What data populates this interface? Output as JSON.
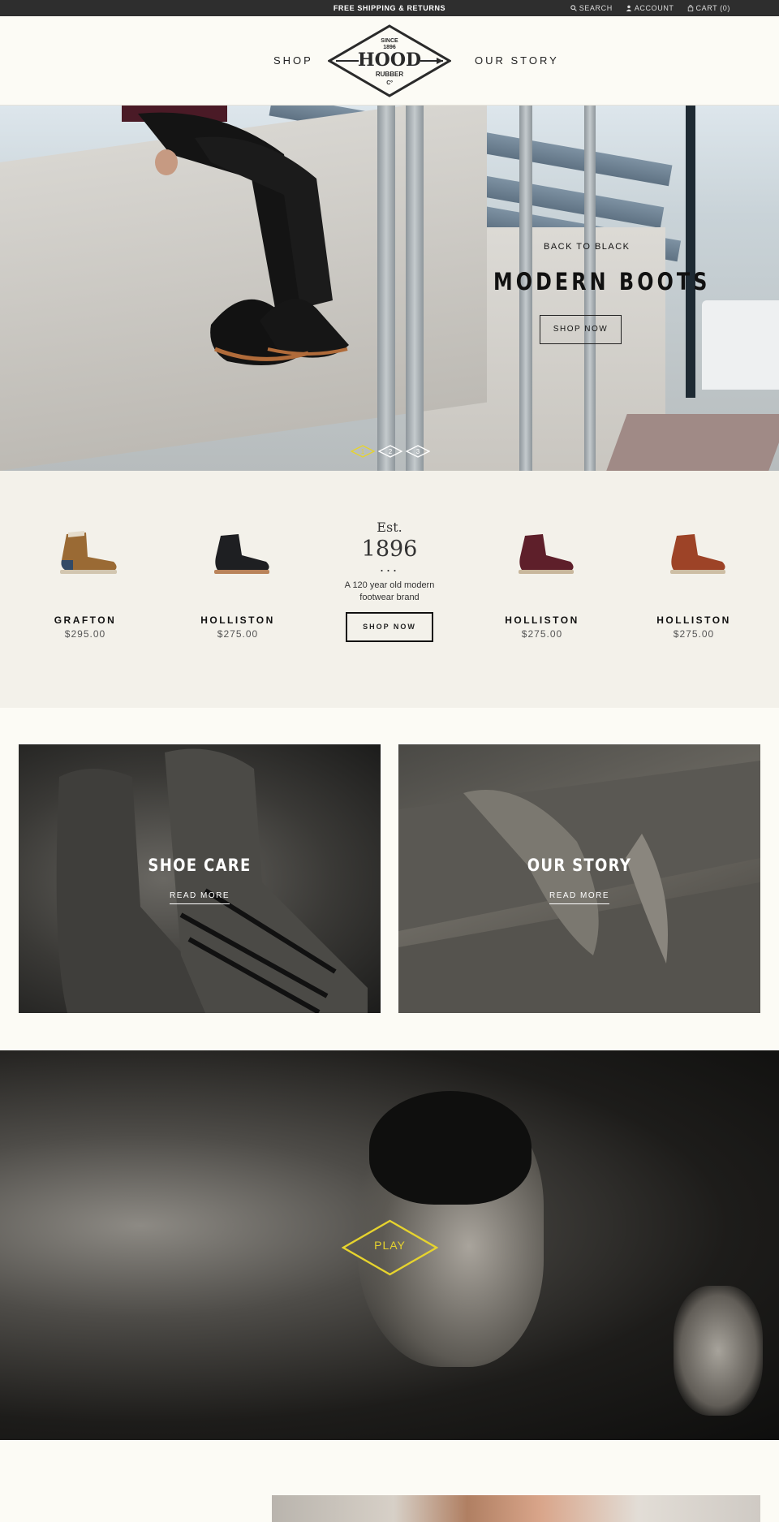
{
  "topbar": {
    "promo": "FREE SHIPPING & RETURNS",
    "search": "SEARCH",
    "account": "ACCOUNT",
    "cart": "CART (0)"
  },
  "header": {
    "nav_shop": "SHOP",
    "nav_story": "OUR STORY",
    "logo": {
      "since": "SINCE",
      "year": "1896",
      "name": "HOOD",
      "rubber": "RUBBER",
      "co": "Cº"
    }
  },
  "hero": {
    "subtitle": "BACK TO BLACK",
    "title": "MODERN BOOTS",
    "button": "SHOP NOW",
    "slides": [
      "1",
      "2",
      "3"
    ],
    "active_slide": 1
  },
  "products": [
    {
      "name": "GRAFTON",
      "price": "$295.00",
      "color": "#9a6a34"
    },
    {
      "name": "HOLLISTON",
      "price": "$275.00",
      "color": "#1e1f22"
    },
    {
      "name": "HOLLISTON",
      "price": "$275.00",
      "color": "#5e1f2a"
    },
    {
      "name": "HOLLISTON",
      "price": "$275.00",
      "color": "#9d4327"
    }
  ],
  "est": {
    "line1": "Est.",
    "line2": "1896",
    "dots": "...",
    "tagline": "A 120 year old modern footwear brand",
    "button": "SHOP NOW"
  },
  "features": [
    {
      "title": "SHOE CARE",
      "link": "READ MORE"
    },
    {
      "title": "OUR STORY",
      "link": "READ MORE"
    }
  ],
  "video": {
    "play": "PLAY",
    "accent": "#e6d32e"
  }
}
